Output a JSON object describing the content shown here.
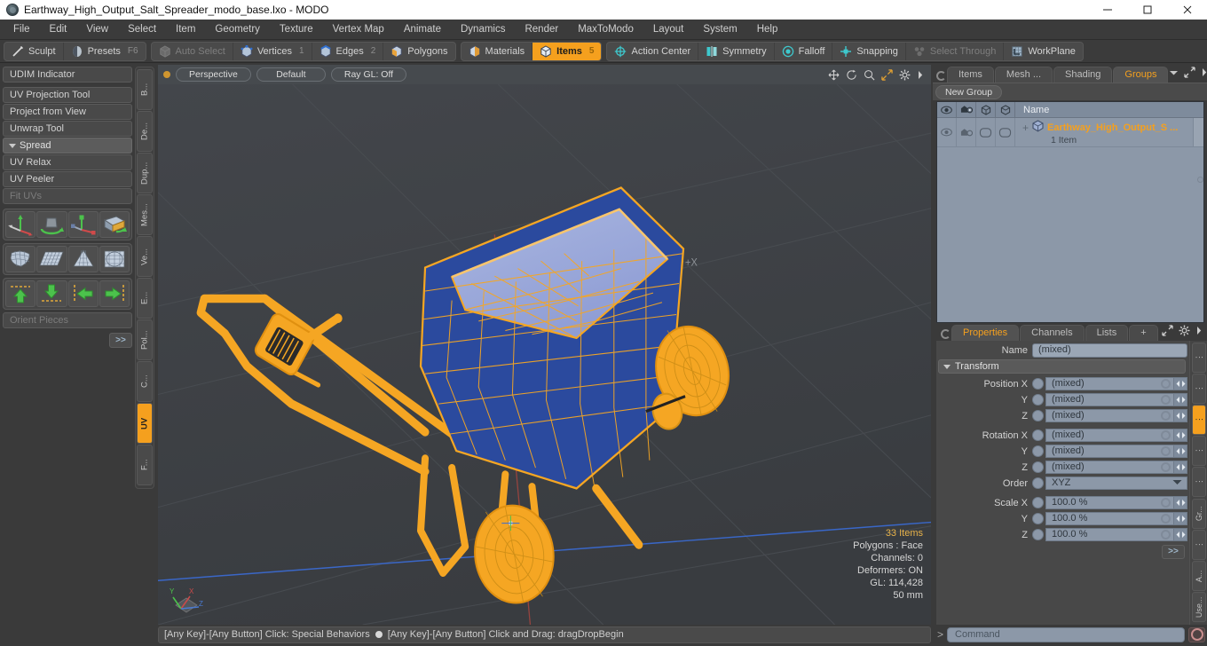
{
  "window": {
    "title": "Earthway_High_Output_Salt_Spreader_modo_base.lxo - MODO",
    "app_icon": "modo-app-icon",
    "minimize": "—",
    "maximize": "☐",
    "close": "✕"
  },
  "menubar": {
    "items": [
      {
        "label": "File"
      },
      {
        "label": "Edit"
      },
      {
        "label": "View"
      },
      {
        "label": "Select"
      },
      {
        "label": "Item"
      },
      {
        "label": "Geometry"
      },
      {
        "label": "Texture"
      },
      {
        "label": "Vertex Map"
      },
      {
        "label": "Animate"
      },
      {
        "label": "Dynamics"
      },
      {
        "label": "Render"
      },
      {
        "label": "MaxToModo"
      },
      {
        "label": "Layout"
      },
      {
        "label": "System"
      },
      {
        "label": "Help"
      }
    ]
  },
  "modebar": {
    "groups": [
      {
        "buttons": [
          {
            "label": "Sculpt",
            "icon": "sculpt-icon",
            "badge": "",
            "state": "normal"
          },
          {
            "label": "Presets",
            "icon": "presets-icon",
            "badge": "F6",
            "state": "normal"
          }
        ]
      },
      {
        "buttons": [
          {
            "label": "Auto Select",
            "icon": "auto-select-icon",
            "badge": "",
            "state": "dim"
          },
          {
            "label": "Vertices",
            "icon": "vertices-icon",
            "badge": "1",
            "state": "normal"
          },
          {
            "label": "Edges",
            "icon": "edges-icon",
            "badge": "2",
            "state": "normal"
          },
          {
            "label": "Polygons",
            "icon": "polygons-icon",
            "badge": "",
            "state": "normal"
          }
        ]
      },
      {
        "buttons": [
          {
            "label": "Materials",
            "icon": "materials-icon",
            "badge": "",
            "state": "normal"
          },
          {
            "label": "Items",
            "icon": "items-icon",
            "badge": "5",
            "state": "active"
          }
        ]
      },
      {
        "buttons": [
          {
            "label": "Action Center",
            "icon": "action-center-icon",
            "badge": "",
            "state": "normal"
          },
          {
            "label": "Symmetry",
            "icon": "symmetry-icon",
            "badge": "",
            "state": "normal"
          },
          {
            "label": "Falloff",
            "icon": "falloff-icon",
            "badge": "",
            "state": "normal"
          },
          {
            "label": "Snapping",
            "icon": "snapping-icon",
            "badge": "",
            "state": "normal"
          },
          {
            "label": "Select Through",
            "icon": "select-through-icon",
            "badge": "",
            "state": "dim"
          },
          {
            "label": "WorkPlane",
            "icon": "workplane-icon",
            "badge": "",
            "state": "normal"
          }
        ]
      }
    ]
  },
  "left_panel": {
    "items": [
      {
        "label": "UDIM Indicator",
        "type": "button",
        "state": "normal"
      },
      {
        "label": "",
        "type": "gap",
        "state": "normal"
      },
      {
        "label": "UV Projection Tool",
        "type": "button",
        "state": "normal"
      },
      {
        "label": "Project from View",
        "type": "button",
        "state": "normal"
      },
      {
        "label": "Unwrap Tool",
        "type": "button",
        "state": "normal"
      },
      {
        "label": "Spread",
        "type": "header",
        "state": "normal"
      },
      {
        "label": "UV Relax",
        "type": "button",
        "state": "normal"
      },
      {
        "label": "UV Peeler",
        "type": "button",
        "state": "normal"
      },
      {
        "label": "Fit UVs",
        "type": "button",
        "state": "dim"
      }
    ],
    "icon_rows": [
      {
        "icons": [
          "uv-move-gizmo-icon",
          "uv-rotate-gizmo-icon",
          "uv-scale-gizmo-icon",
          "uv-flip-icon"
        ]
      },
      {
        "icons": [
          "uv-unwrap-sphere-icon",
          "uv-grid-plane-icon",
          "uv-cone-unwrap-icon",
          "uv-sphere-grid-icon"
        ]
      },
      {
        "icons": [
          "align-up-icon",
          "align-down-icon",
          "align-left-icon",
          "align-right-icon"
        ]
      }
    ],
    "orient_pieces": "Orient Pieces",
    "more_button": ">>",
    "vtabs": [
      {
        "label": "B...",
        "active": false
      },
      {
        "label": "De...",
        "active": false
      },
      {
        "label": "Dup...",
        "active": false
      },
      {
        "label": "Mes...",
        "active": false
      },
      {
        "label": "Ve...",
        "active": false
      },
      {
        "label": "E...",
        "active": false
      },
      {
        "label": "Pol...",
        "active": false
      },
      {
        "label": "C...",
        "active": false
      },
      {
        "label": "UV",
        "active": true
      },
      {
        "label": "F...",
        "active": false
      }
    ]
  },
  "viewport": {
    "pills": [
      {
        "label": "Perspective"
      },
      {
        "label": "Default"
      },
      {
        "label": "Ray GL: Off"
      }
    ],
    "header_icons": [
      "pan-icon",
      "rotate-icon",
      "zoom-icon",
      "fullscreen-icon",
      "gear-icon",
      "chevron-right-icon"
    ],
    "axis_label": "+X",
    "stats": {
      "items": "33 Items",
      "polygons": "Polygons : Face",
      "channels": "Channels: 0",
      "deformers": "Deformers: ON",
      "gl": "GL: 114,428",
      "scale": "50 mm"
    },
    "gizmo_axes": [
      "Y",
      "X",
      "Z"
    ],
    "colors": {
      "background": "#3e4145",
      "wireframe": "#f5a623",
      "surface": "#2a4a9c",
      "x_axis": "#a04a4a",
      "z_axis": "#3a6ad0",
      "grid": "#4a4d51"
    }
  },
  "right_panel": {
    "top_tabs": [
      {
        "label": "Items",
        "active": false
      },
      {
        "label": "Mesh ...",
        "active": false
      },
      {
        "label": "Shading",
        "active": false
      },
      {
        "label": "Groups",
        "active": true
      }
    ],
    "top_tab_icons": [
      "chevron-down-icon",
      "expand-icon",
      "chevron-right-icon"
    ],
    "new_group_button": "New Group",
    "tree": {
      "columns": [
        "eye-icon",
        "render-icon",
        "shaded-box-icon",
        "wire-box-icon"
      ],
      "name_header": "Name",
      "rows": [
        {
          "label": "Earthway_High_Output_S ...",
          "subtitle": "1 Item",
          "icon": "group-mesh-icon",
          "expander": "+"
        }
      ]
    },
    "properties": {
      "tabs": [
        {
          "label": "Properties",
          "active": true
        },
        {
          "label": "Channels",
          "active": false
        },
        {
          "label": "Lists",
          "active": false
        },
        {
          "label": "+",
          "active": false
        }
      ],
      "tab_icons": [
        "expand-icon",
        "gear-icon",
        "chevron-right-icon"
      ],
      "name_label": "Name",
      "name_value": "(mixed)",
      "transform_group": "Transform",
      "fields": [
        {
          "label": "Position X",
          "value": "(mixed)",
          "type": "value"
        },
        {
          "label": "Y",
          "value": "(mixed)",
          "type": "value"
        },
        {
          "label": "Z",
          "value": "(mixed)",
          "type": "value"
        },
        {
          "label": "Rotation X",
          "value": "(mixed)",
          "type": "value"
        },
        {
          "label": "Y",
          "value": "(mixed)",
          "type": "value"
        },
        {
          "label": "Z",
          "value": "(mixed)",
          "type": "value"
        },
        {
          "label": "Order",
          "value": "XYZ",
          "type": "dropdown"
        },
        {
          "label": "Scale X",
          "value": "100.0 %",
          "type": "value"
        },
        {
          "label": "Y",
          "value": "100.0 %",
          "type": "value"
        },
        {
          "label": "Z",
          "value": "100.0 %",
          "type": "value"
        }
      ],
      "more_button": ">>",
      "vtabs": [
        {
          "label": "⋮",
          "active": false
        },
        {
          "label": "⋮",
          "active": false
        },
        {
          "label": "⋮",
          "active": true
        },
        {
          "label": "⋮",
          "active": false
        },
        {
          "label": "⋮",
          "active": false
        },
        {
          "label": "Gr...",
          "active": false
        },
        {
          "label": "⋮",
          "active": false
        },
        {
          "label": "A...",
          "active": false
        },
        {
          "label": "Use...",
          "active": false
        }
      ]
    }
  },
  "statusbar": {
    "hint_left": "[Any Key]-[Any Button] Click: Special Behaviors",
    "hint_right": "[Any Key]-[Any Button] Click and Drag: dragDropBegin",
    "command_prompt": ">",
    "command_placeholder": "Command",
    "record_icon": "record-icon"
  }
}
